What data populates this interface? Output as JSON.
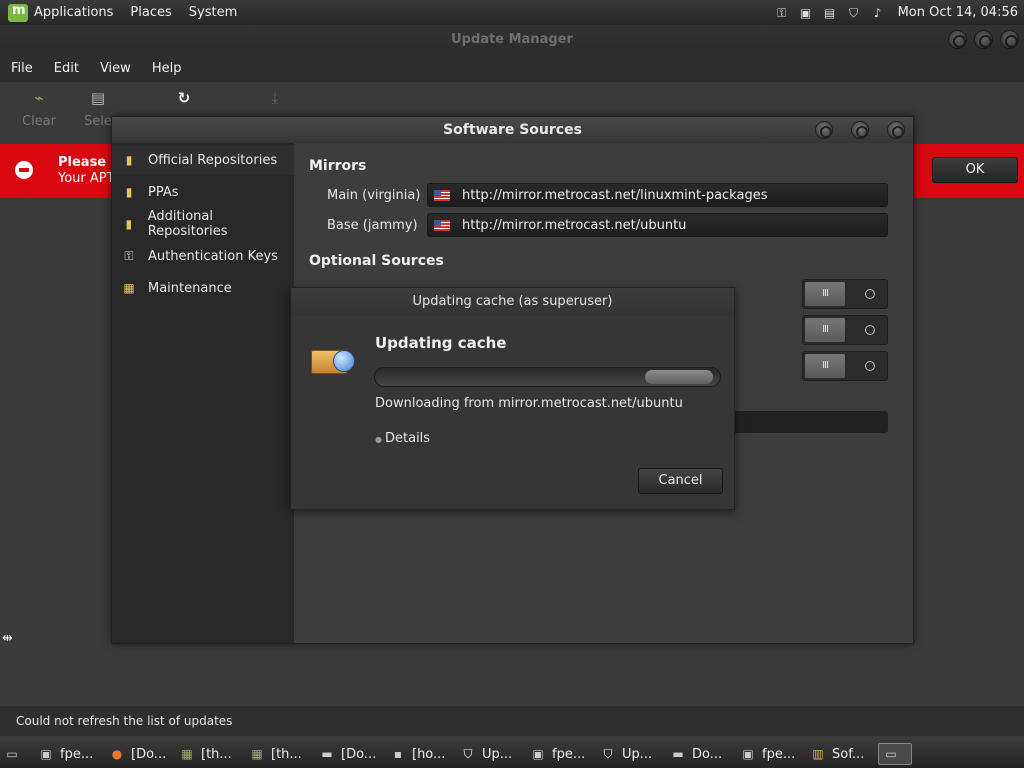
{
  "top_panel": {
    "menus": [
      "Applications",
      "Places",
      "System"
    ],
    "tray_icons": [
      "key-icon",
      "network-icon",
      "clipboard-icon",
      "shield-icon",
      "volume-icon"
    ],
    "clock": "Mon Oct 14, 04:56"
  },
  "update_manager": {
    "title": "Update Manager",
    "menus": [
      "File",
      "Edit",
      "View",
      "Help"
    ],
    "toolbar": {
      "clear_label": "Clear",
      "select_label": "Sele"
    },
    "banner": {
      "title": "Please s",
      "subtitle": "Your APT",
      "ok_label": "OK"
    },
    "status": "Could not refresh the list of updates"
  },
  "software_sources": {
    "title": "Software Sources",
    "sidebar": [
      {
        "label": "Official Repositories",
        "icon": "repository-icon"
      },
      {
        "label": "PPAs",
        "icon": "repository-icon"
      },
      {
        "label": "Additional Repositories",
        "icon": "repository-icon"
      },
      {
        "label": "Authentication Keys",
        "icon": "key-icon"
      },
      {
        "label": "Maintenance",
        "icon": "maintenance-icon"
      }
    ],
    "mirrors_title": "Mirrors",
    "mirrors": [
      {
        "label": "Main (virginia)",
        "url": "http://mirror.metrocast.net/linuxmint-packages"
      },
      {
        "label": "Base (jammy)",
        "url": "http://mirror.metrocast.net/ubuntu"
      }
    ],
    "optional_title": "Optional Sources",
    "toggle_on_symbol": "III"
  },
  "updating_dialog": {
    "title": "Updating cache (as superuser)",
    "heading": "Updating cache",
    "downloading": "Downloading from mirror.metrocast.net/ubuntu",
    "details_label": "Details",
    "cancel_label": "Cancel"
  },
  "taskbar": [
    {
      "label": "fpe...",
      "icon": "terminal-icon"
    },
    {
      "label": "[Do...",
      "icon": "firefox-icon"
    },
    {
      "label": "[th...",
      "icon": "archive-icon"
    },
    {
      "label": "[th...",
      "icon": "archive-icon"
    },
    {
      "label": "[Do...",
      "icon": "folder-icon"
    },
    {
      "label": "[ho...",
      "icon": "disk-icon"
    },
    {
      "label": "Up...",
      "icon": "shield-icon"
    },
    {
      "label": "fpe...",
      "icon": "terminal-icon"
    },
    {
      "label": "Up...",
      "icon": "shield-icon"
    },
    {
      "label": "Do...",
      "icon": "folder-icon"
    },
    {
      "label": "fpe...",
      "icon": "terminal-icon"
    },
    {
      "label": "Sof...",
      "icon": "package-icon"
    }
  ],
  "colors": {
    "error_banner": "#d8090e",
    "panel": "#2b2b2b"
  }
}
